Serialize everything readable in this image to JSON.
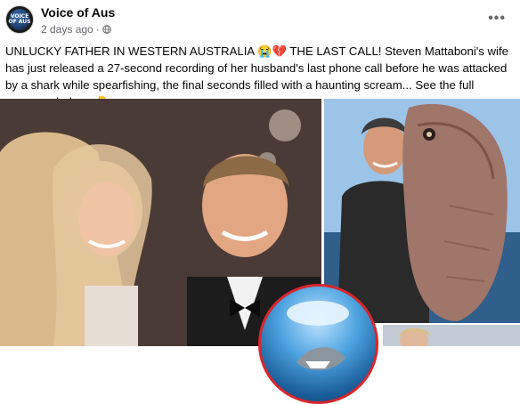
{
  "post": {
    "page_name": "Voice of Aus",
    "avatar_label": "VOICE OF AUS",
    "timestamp": "2 days ago",
    "more_label": "•••",
    "text": "UNLUCKY FATHER IN WESTERN AUSTRALIA 😭💔 THE LAST CALL! Steven Mattaboni's wife has just released a 27-second recording of her husband's last phone call before he was attacked by a shark while spearfishing, the final seconds filled with a haunting scream... See the full message below...👇"
  },
  "icons": {
    "globe": "globe-icon",
    "more": "more-options-icon"
  },
  "colors": {
    "meta_text": "#65676b",
    "circle_border": "#d9262c"
  }
}
